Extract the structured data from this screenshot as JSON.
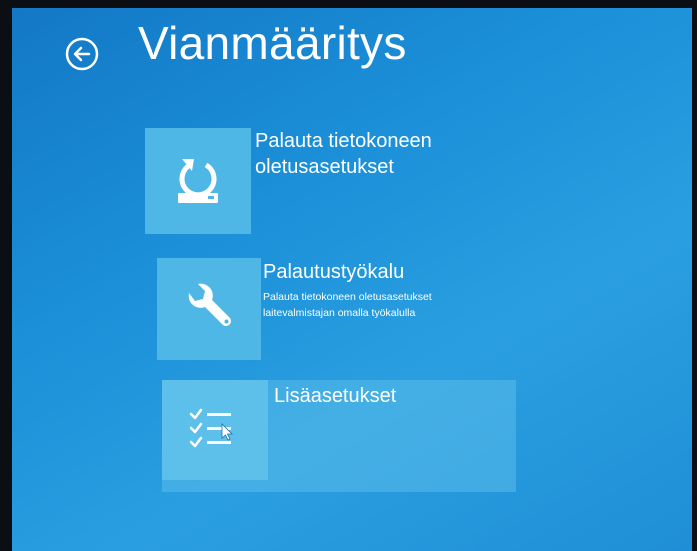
{
  "header": {
    "title": "Vianmääritys",
    "back_icon": "back-arrow-circle-icon"
  },
  "options": [
    {
      "title": "Palauta tietokoneen\noletusasetukset",
      "icon": "refresh-drive-icon"
    },
    {
      "title": "Palautustyökalu",
      "description": "Palauta tietokoneen oletusasetukset\nlaitevalmistajan omalla työkalulla",
      "icon": "wrench-icon"
    },
    {
      "title": "Lisäasetukset",
      "icon": "checklist-icon"
    }
  ],
  "colors": {
    "background": "#1b8fd8",
    "tile": "#4fb7e6",
    "text": "#ffffff"
  }
}
